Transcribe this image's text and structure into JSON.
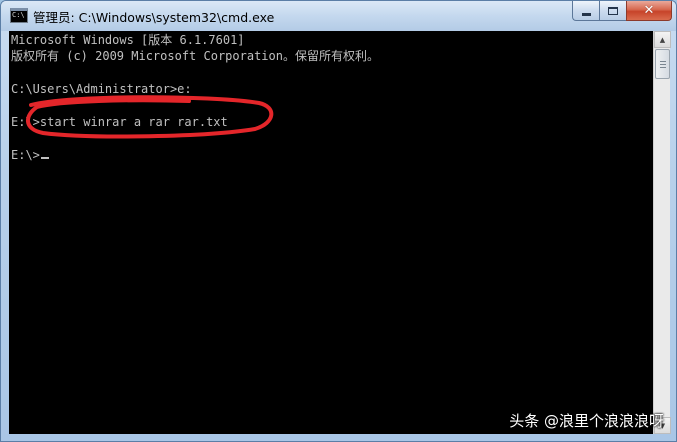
{
  "window": {
    "title": "管理员: C:\\Windows\\system32\\cmd.exe",
    "icon": "cmd-icon",
    "icon_text": "C:\\"
  },
  "controls": {
    "minimize_icon": "minimize-icon",
    "maximize_icon": "maximize-icon",
    "close_icon": "close-icon",
    "close_glyph": "✕"
  },
  "console": {
    "lines": [
      "Microsoft Windows [版本 6.1.7601]",
      "版权所有 (c) 2009 Microsoft Corporation。保留所有权利。",
      "",
      "C:\\Users\\Administrator>e:",
      "",
      "E:\\>start winrar a rar rar.txt",
      "",
      "E:\\>"
    ],
    "highlight_color": "#e4262a",
    "text_color": "#c0c0c0",
    "background": "#000000"
  },
  "scrollbar": {
    "up_glyph": "▲",
    "down_glyph": "▼"
  },
  "watermark": {
    "text": "头条 @浪里个浪浪浪呀"
  }
}
